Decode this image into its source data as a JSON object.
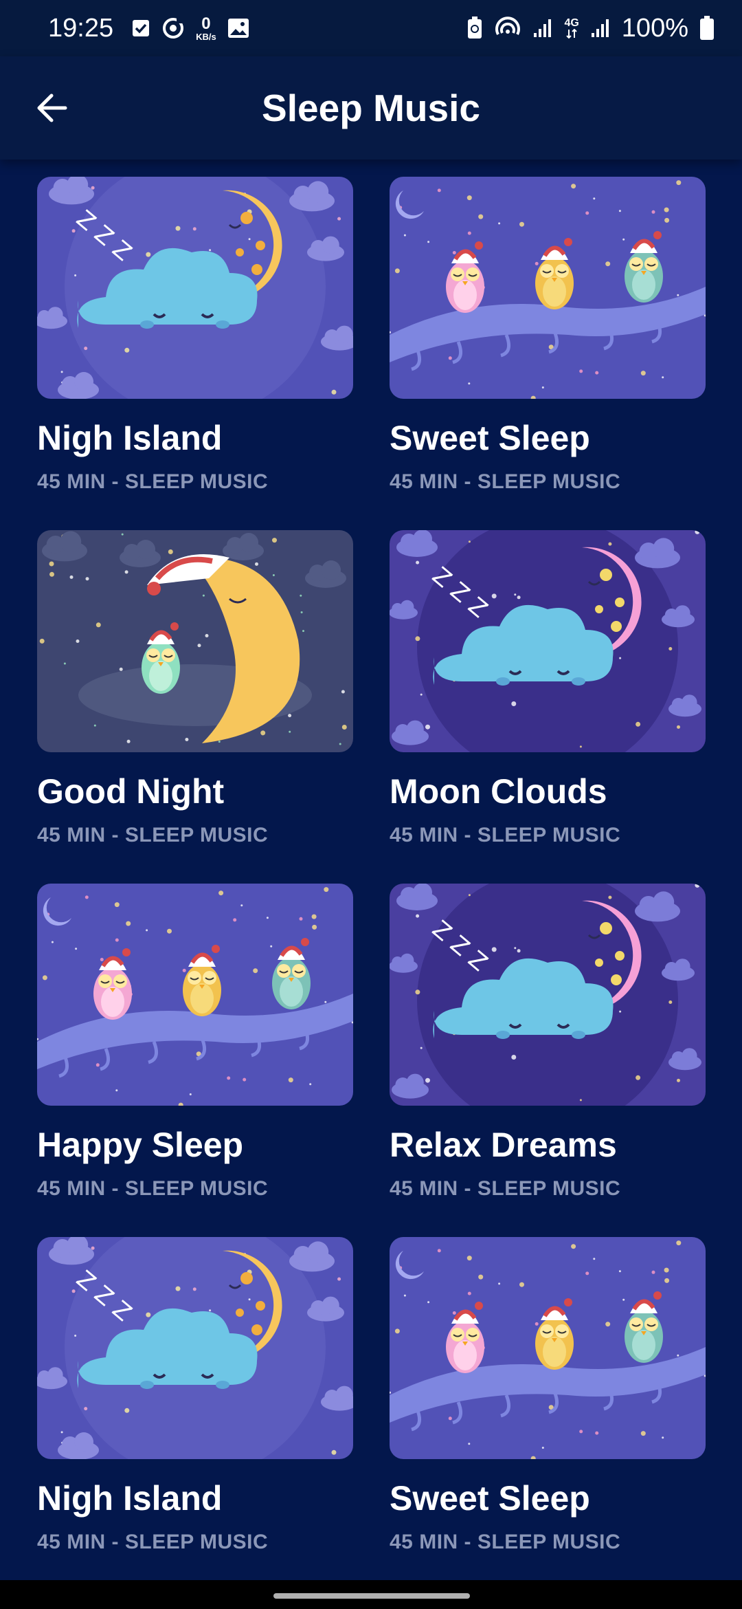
{
  "status_bar": {
    "time": "19:25",
    "net_speed_value": "0",
    "net_speed_unit": "KB/s",
    "network_type": "4G",
    "battery": "100%"
  },
  "header": {
    "title": "Sleep Music"
  },
  "tracks": [
    {
      "title": "Nigh Island",
      "subtitle": "45 MIN - SLEEP MUSIC",
      "art": "cloud-moon-yellow"
    },
    {
      "title": "Sweet Sleep",
      "subtitle": "45 MIN - SLEEP MUSIC",
      "art": "owls-on-branch"
    },
    {
      "title": "Good Night",
      "subtitle": "45 MIN - SLEEP MUSIC",
      "art": "owl-on-moon"
    },
    {
      "title": "Moon Clouds",
      "subtitle": "45 MIN - SLEEP MUSIC",
      "art": "cloud-moon-pink"
    },
    {
      "title": "Happy Sleep",
      "subtitle": "45 MIN - SLEEP MUSIC",
      "art": "owls-on-branch"
    },
    {
      "title": "Relax Dreams",
      "subtitle": "45 MIN - SLEEP MUSIC",
      "art": "cloud-moon-pink"
    },
    {
      "title": "Nigh Island",
      "subtitle": "45 MIN - SLEEP MUSIC",
      "art": "cloud-moon-yellow"
    },
    {
      "title": "Sweet Sleep",
      "subtitle": "45 MIN - SLEEP MUSIC",
      "art": "owls-on-branch"
    }
  ],
  "colors": {
    "background": "#03174C",
    "subtitle": "#8B97B8"
  }
}
